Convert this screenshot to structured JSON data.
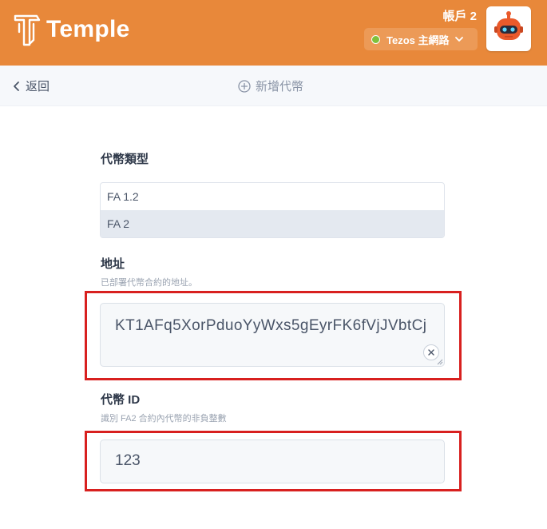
{
  "header": {
    "brand": "Temple",
    "account_name": "帳戶 2",
    "network_label": "Tezos 主網路",
    "network_status_color": "#7fc03b",
    "brand_color": "#e8883a"
  },
  "nav": {
    "back_label": "返回",
    "title": "新增代幣"
  },
  "form": {
    "token_type": {
      "label": "代幣類型",
      "options": [
        "FA 1.2",
        "FA 2"
      ],
      "selected": "FA 2"
    },
    "address": {
      "label": "地址",
      "hint": "已部署代幣合約的地址。",
      "value": "KT1AFq5XorPduoYyWxs5gEyrFK6fVjJVbtCj"
    },
    "token_id": {
      "label": "代幣 ID",
      "hint": "識別 FA2 合約內代幣的非負整數",
      "value": "123"
    }
  },
  "highlight_color": "#d8201f"
}
